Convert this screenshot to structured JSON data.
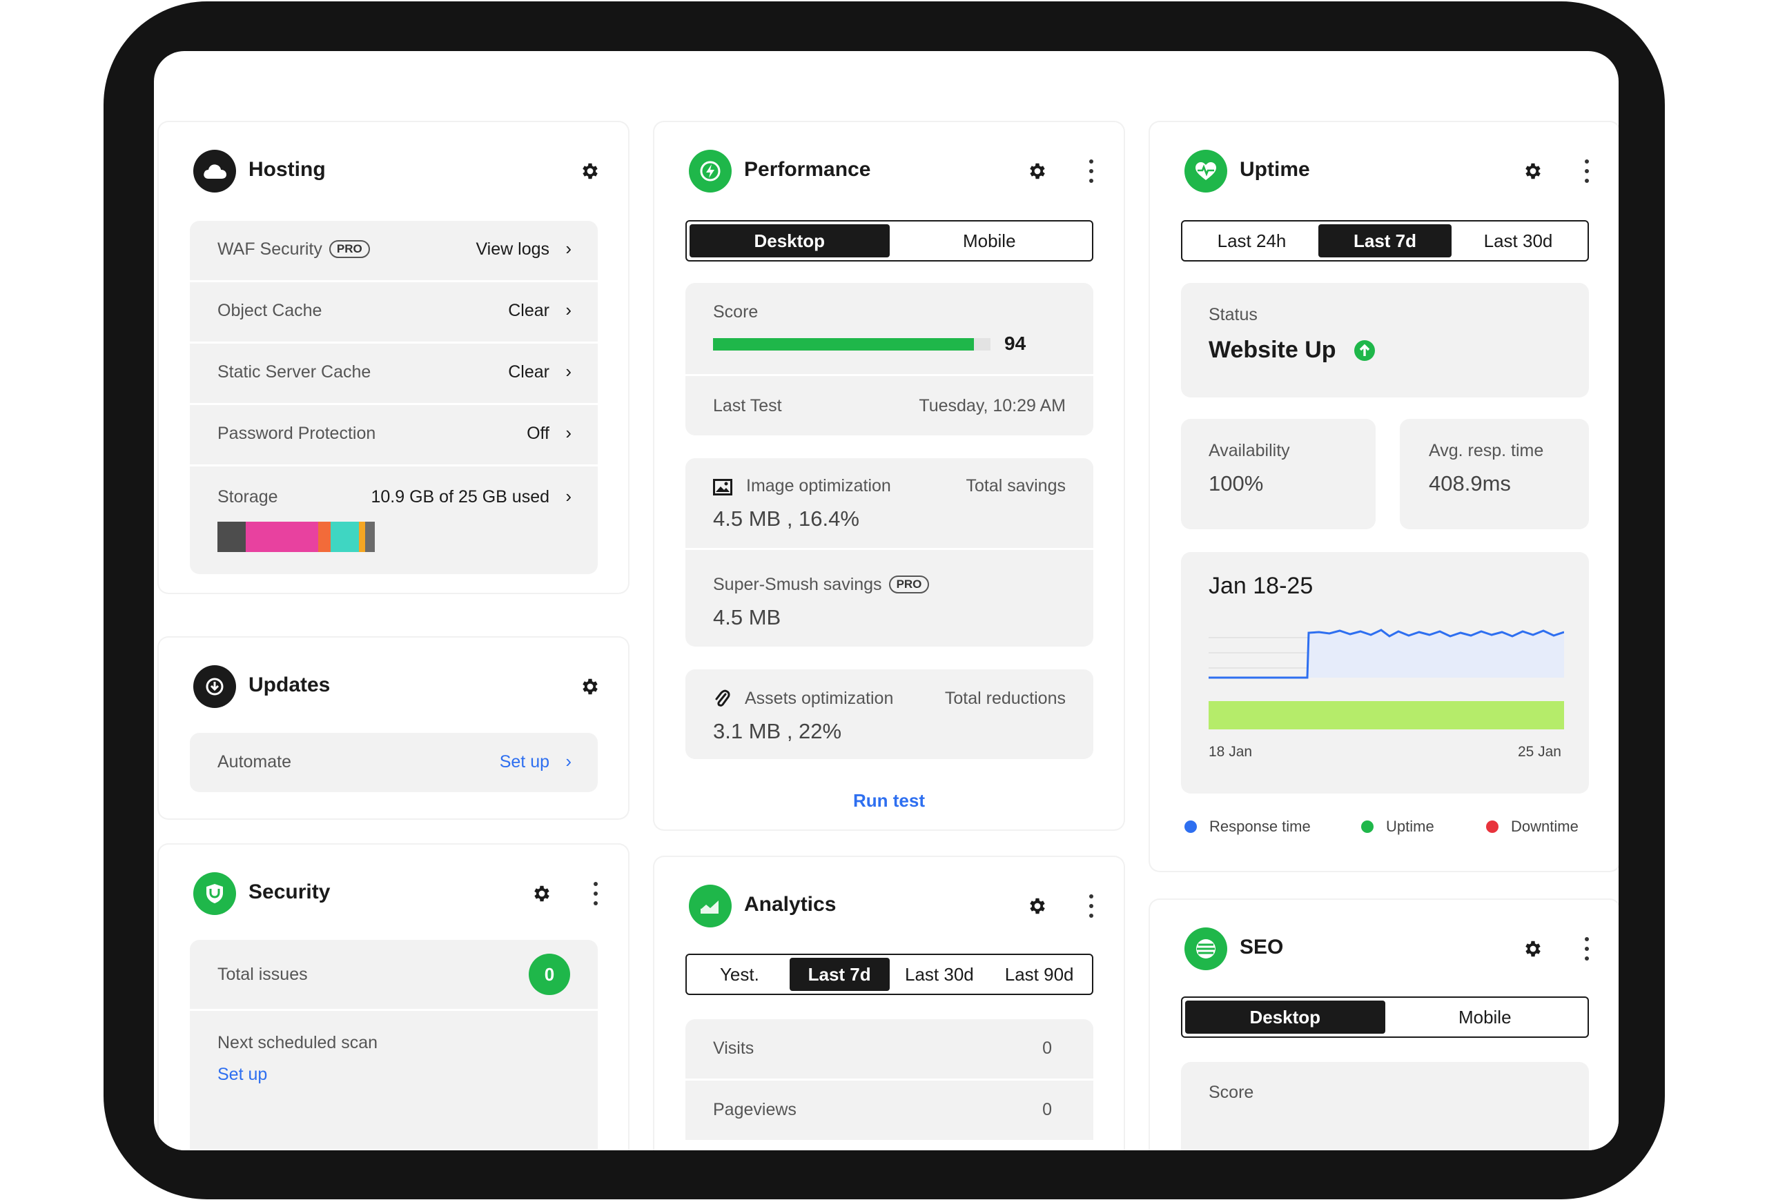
{
  "hosting": {
    "title": "Hosting",
    "rows": [
      {
        "label": "WAF Security",
        "badge": "PRO",
        "value": "View logs"
      },
      {
        "label": "Object Cache",
        "value": "Clear"
      },
      {
        "label": "Static Server Cache",
        "value": "Clear"
      },
      {
        "label": "Password Protection",
        "value": "Off"
      },
      {
        "label": "Storage",
        "value": "10.9 GB of 25 GB used"
      }
    ],
    "storage_segments": [
      {
        "color": "#4d4d4d",
        "fraction": 0.18
      },
      {
        "color": "#e8419f",
        "fraction": 0.46
      },
      {
        "color": "#f26b3a",
        "fraction": 0.08
      },
      {
        "color": "#3fd6c2",
        "fraction": 0.18
      },
      {
        "color": "#f5a623",
        "fraction": 0.04
      },
      {
        "color": "#6b6b6b",
        "fraction": 0.06
      }
    ]
  },
  "updates": {
    "title": "Updates",
    "row": {
      "label": "Automate",
      "value": "Set up"
    }
  },
  "security": {
    "title": "Security",
    "total_issues_label": "Total issues",
    "total_issues_value": "0",
    "next_scan_label": "Next scheduled scan",
    "next_scan_link": "Set up"
  },
  "performance": {
    "title": "Performance",
    "tabs": [
      "Desktop",
      "Mobile"
    ],
    "active_tab": "Desktop",
    "score_label": "Score",
    "score_value": "94",
    "score_fraction": 0.94,
    "last_test_label": "Last Test",
    "last_test_value": "Tuesday, 10:29 AM",
    "image_opt_label": "Image optimization",
    "image_opt_side": "Total savings",
    "image_opt_value": "4.5 MB , 16.4%",
    "smush_label": "Super-Smush savings",
    "smush_badge": "PRO",
    "smush_value": "4.5 MB",
    "assets_label": "Assets optimization",
    "assets_side": "Total reductions",
    "assets_value": "3.1 MB , 22%",
    "run_test": "Run test"
  },
  "analytics": {
    "title": "Analytics",
    "tabs": [
      "Yest.",
      "Last 7d",
      "Last 30d",
      "Last 90d"
    ],
    "active_tab": "Last 7d",
    "rows": [
      {
        "label": "Visits",
        "value": "0"
      },
      {
        "label": "Pageviews",
        "value": "0"
      }
    ]
  },
  "uptime": {
    "title": "Uptime",
    "tabs": [
      "Last 24h",
      "Last 7d",
      "Last 30d"
    ],
    "active_tab": "Last 7d",
    "status_label": "Status",
    "status_value": "Website Up",
    "availability_label": "Availability",
    "availability_value": "100%",
    "resp_label": "Avg. resp. time",
    "resp_value": "408.9ms",
    "range_label": "Jan 18-25",
    "x_start": "18 Jan",
    "x_end": "25 Jan",
    "legend": [
      {
        "name": "Response time",
        "color": "#2e6ff0"
      },
      {
        "name": "Uptime",
        "color": "#1fb74a"
      },
      {
        "name": "Downtime",
        "color": "#e8333c"
      }
    ]
  },
  "seo": {
    "title": "SEO",
    "tabs": [
      "Desktop",
      "Mobile"
    ],
    "active_tab": "Desktop",
    "score_label": "Score"
  },
  "colors": {
    "accent_green": "#1fb74a",
    "link_blue": "#2e6ff0",
    "uptime_bar": "#b5ec6a"
  }
}
